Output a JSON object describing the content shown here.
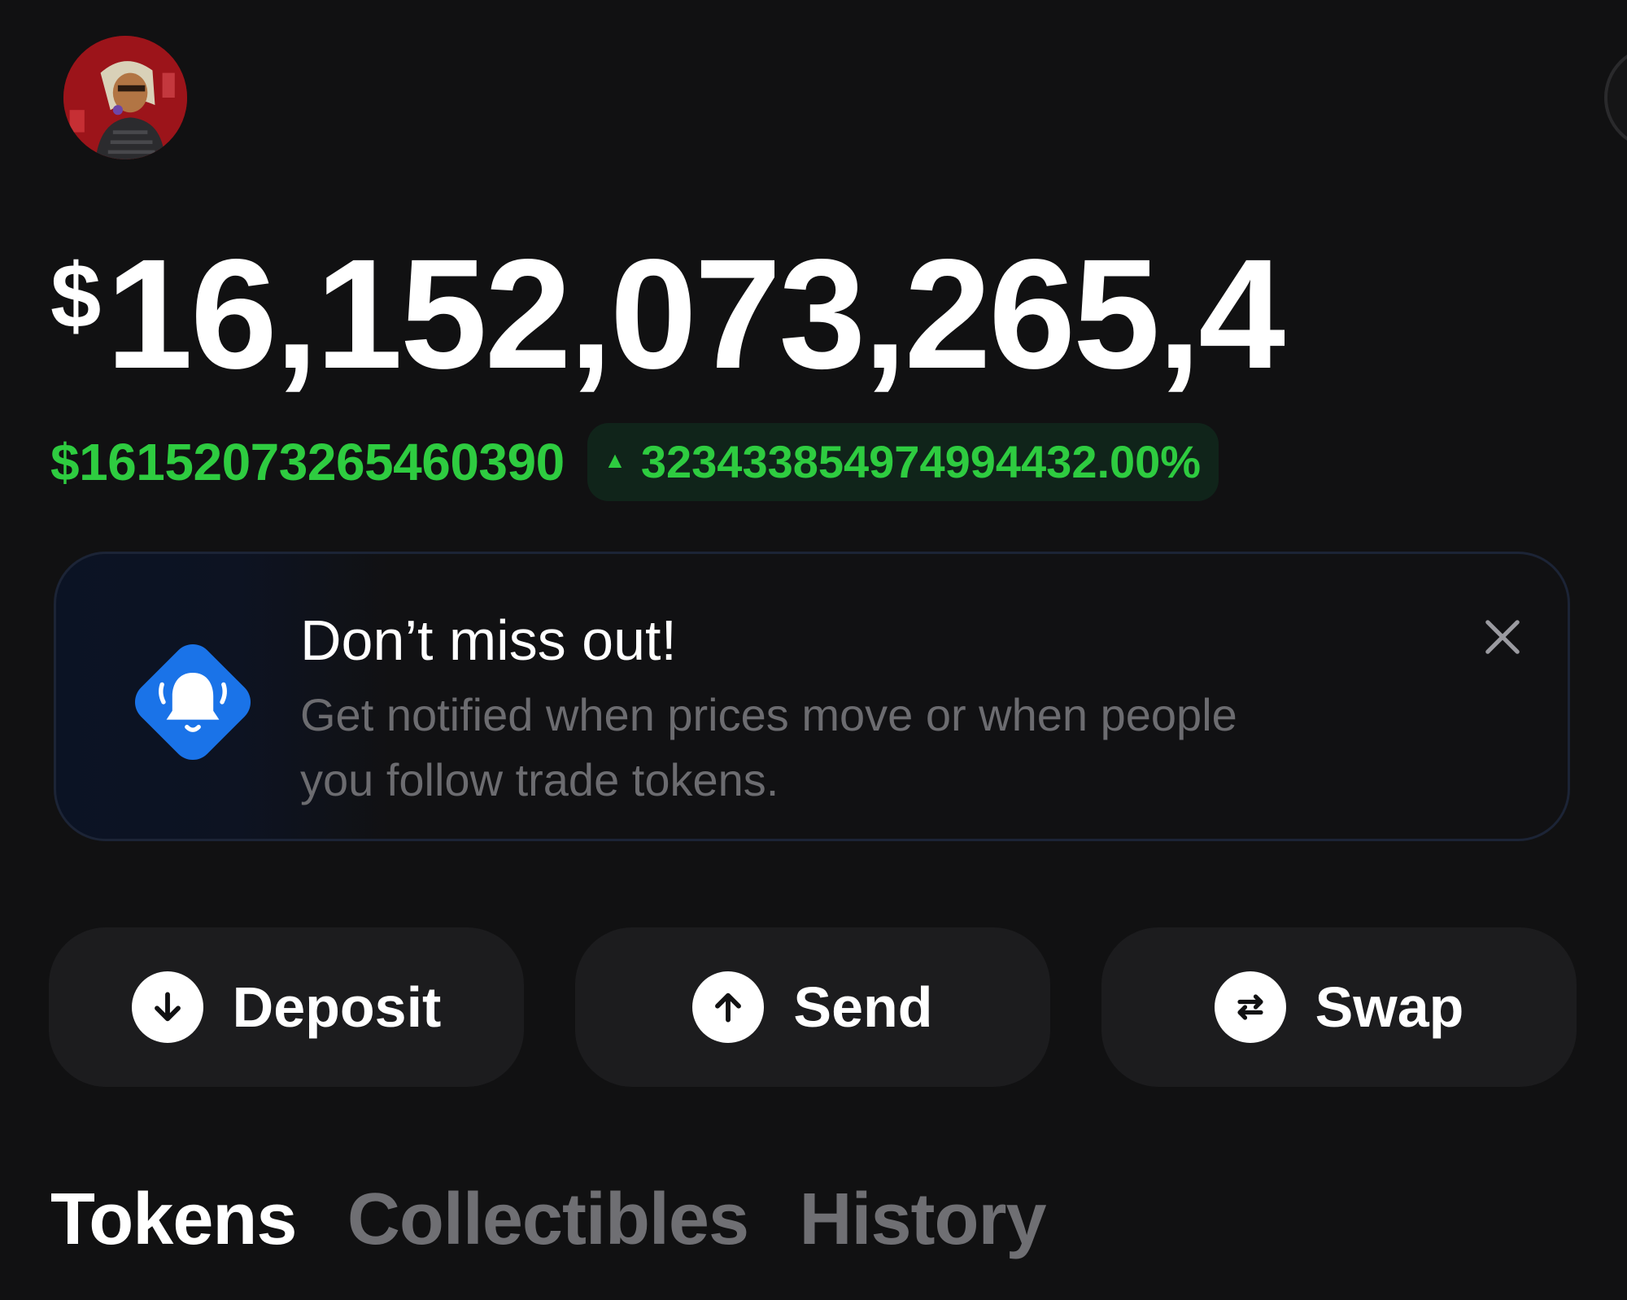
{
  "header": {
    "avatar_icon": "user-avatar-icon",
    "edge_button_icon": "circle-button-icon"
  },
  "balance": {
    "currency_symbol": "$",
    "value": "16,152,073,265,4"
  },
  "change": {
    "amount": "$16152073265460390",
    "direction_icon": "▲",
    "percent": "32343385497499443 2.00%",
    "color": "#2ecc40"
  },
  "notice": {
    "title": "Don’t miss out!",
    "body": "Get notified when prices move or when people you follow trade tokens.",
    "icon": "bell-icon",
    "close_icon": "close-icon",
    "accent": "#1a73e8"
  },
  "actions": {
    "deposit": {
      "label": "Deposit",
      "icon": "arrow-down-icon"
    },
    "send": {
      "label": "Send",
      "icon": "arrow-up-icon"
    },
    "swap": {
      "label": "Swap",
      "icon": "swap-arrows-icon"
    }
  },
  "tabs": [
    {
      "label": "Tokens",
      "active": true
    },
    {
      "label": "Collectibles",
      "active": false
    },
    {
      "label": "History",
      "active": false
    }
  ]
}
